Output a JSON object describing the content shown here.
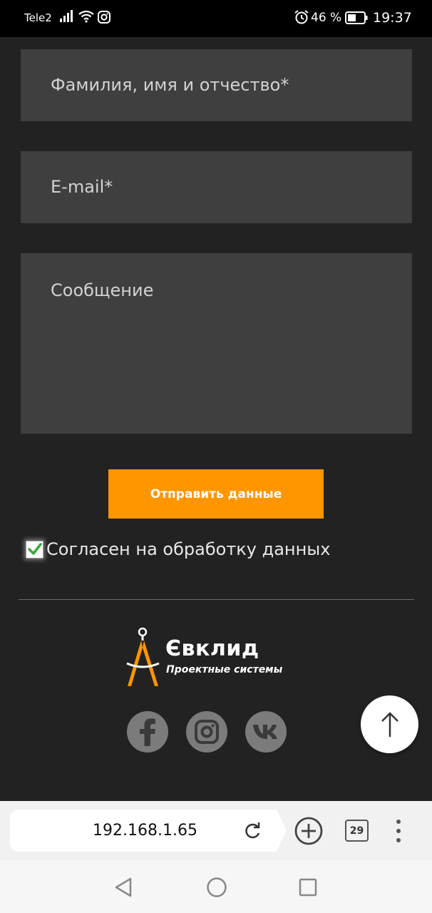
{
  "status_bar": {
    "carrier": "Tele2",
    "battery_percent": "46 %",
    "time": "19:37",
    "icons": [
      "signal-icon",
      "wifi-icon",
      "instagram-notification-icon",
      "alarm-icon",
      "battery-icon"
    ]
  },
  "form": {
    "name_placeholder": "Фамилия, имя и отчество*",
    "email_placeholder": "E-mail*",
    "message_placeholder": "Сообщение",
    "submit_label": "Отправить данные",
    "consent_label": "Согласен на обработку данных",
    "consent_checked": true
  },
  "footer": {
    "logo_name": "Євклид",
    "logo_tagline": "Проектные системы",
    "social": [
      "facebook-icon",
      "instagram-icon",
      "vk-icon"
    ]
  },
  "browser": {
    "url": "192.168.1.65",
    "tab_count": "29"
  },
  "colors": {
    "background": "#222222",
    "field": "#3f3f3f",
    "accent": "#ff9600",
    "social": "#7b7b7b"
  }
}
